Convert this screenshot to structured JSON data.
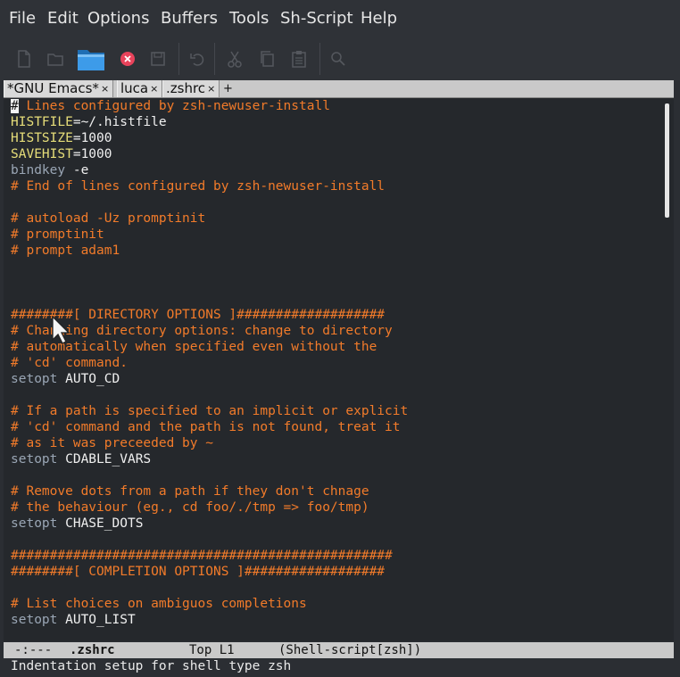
{
  "menubar": {
    "items": [
      "File",
      "Edit",
      "Options",
      "Buffers",
      "Tools",
      "Sh-Script",
      "Help"
    ]
  },
  "toolbar": {
    "icons": [
      "new-file-icon",
      "open-directory-icon",
      "open-folder-icon",
      "close-icon",
      "save-icon",
      "undo-icon",
      "cut-icon",
      "copy-icon",
      "paste-icon",
      "search-icon"
    ]
  },
  "tabs": [
    {
      "label": "*GNU Emacs*",
      "close": "×"
    },
    {
      "label": "luca",
      "close": "×"
    },
    {
      "label": ".zshrc",
      "close": "×"
    }
  ],
  "tab_add": "+",
  "editor": {
    "cursor_char": "#",
    "lines": [
      {
        "type": "comment",
        "text": " Lines configured by zsh-newuser-install"
      },
      {
        "type": "assign",
        "name": "HISTFILE",
        "value": "=~/.histfile"
      },
      {
        "type": "assign",
        "name": "HISTSIZE",
        "value": "=1000"
      },
      {
        "type": "assign",
        "name": "SAVEHIST",
        "value": "=1000"
      },
      {
        "type": "cmd",
        "cmd": "bindkey",
        "arg": " -e"
      },
      {
        "type": "comment",
        "text": "# End of lines configured by zsh-newuser-install"
      },
      {
        "type": "blank",
        "text": ""
      },
      {
        "type": "comment",
        "text": "# autoload -Uz promptinit"
      },
      {
        "type": "comment",
        "text": "# promptinit"
      },
      {
        "type": "comment",
        "text": "# prompt adam1"
      },
      {
        "type": "blank",
        "text": ""
      },
      {
        "type": "blank",
        "text": ""
      },
      {
        "type": "blank",
        "text": ""
      },
      {
        "type": "comment",
        "text": "########[ DIRECTORY OPTIONS ]###################"
      },
      {
        "type": "comment",
        "text": "# Changing directory options: change to directory"
      },
      {
        "type": "comment",
        "text": "# automatically when specified even without the"
      },
      {
        "type": "comment",
        "text": "# 'cd' command."
      },
      {
        "type": "cmd",
        "cmd": "setopt",
        "arg": " AUTO_CD"
      },
      {
        "type": "blank",
        "text": ""
      },
      {
        "type": "comment",
        "text": "# If a path is specified to an implicit or explicit"
      },
      {
        "type": "comment",
        "text": "# 'cd' command and the path is not found, treat it"
      },
      {
        "type": "comment",
        "text": "# as it was preceeded by ~"
      },
      {
        "type": "cmd",
        "cmd": "setopt",
        "arg": " CDABLE_VARS"
      },
      {
        "type": "blank",
        "text": ""
      },
      {
        "type": "comment",
        "text": "# Remove dots from a path if they don't chnage"
      },
      {
        "type": "comment",
        "text": "# the behaviour (eg., cd foo/./tmp => foo/tmp)"
      },
      {
        "type": "cmd",
        "cmd": "setopt",
        "arg": " CHASE_DOTS"
      },
      {
        "type": "blank",
        "text": ""
      },
      {
        "type": "comment",
        "text": "#################################################"
      },
      {
        "type": "comment",
        "text": "########[ COMPLETION OPTIONS ]##################"
      },
      {
        "type": "blank",
        "text": ""
      },
      {
        "type": "comment",
        "text": "# List choices on ambiguos completions"
      },
      {
        "type": "cmd",
        "cmd": "setopt",
        "arg": " AUTO_LIST"
      }
    ]
  },
  "modeline": {
    "status": "-:---",
    "buffer": ".zshrc",
    "position": "Top L1",
    "mode": "(Shell-script[zsh])"
  },
  "echo_area": "Indentation setup for shell type zsh",
  "colors": {
    "comment": "#f27b2a",
    "variable": "#e6dd79",
    "builtin": "#9aa6b5",
    "background": "#25282c"
  }
}
